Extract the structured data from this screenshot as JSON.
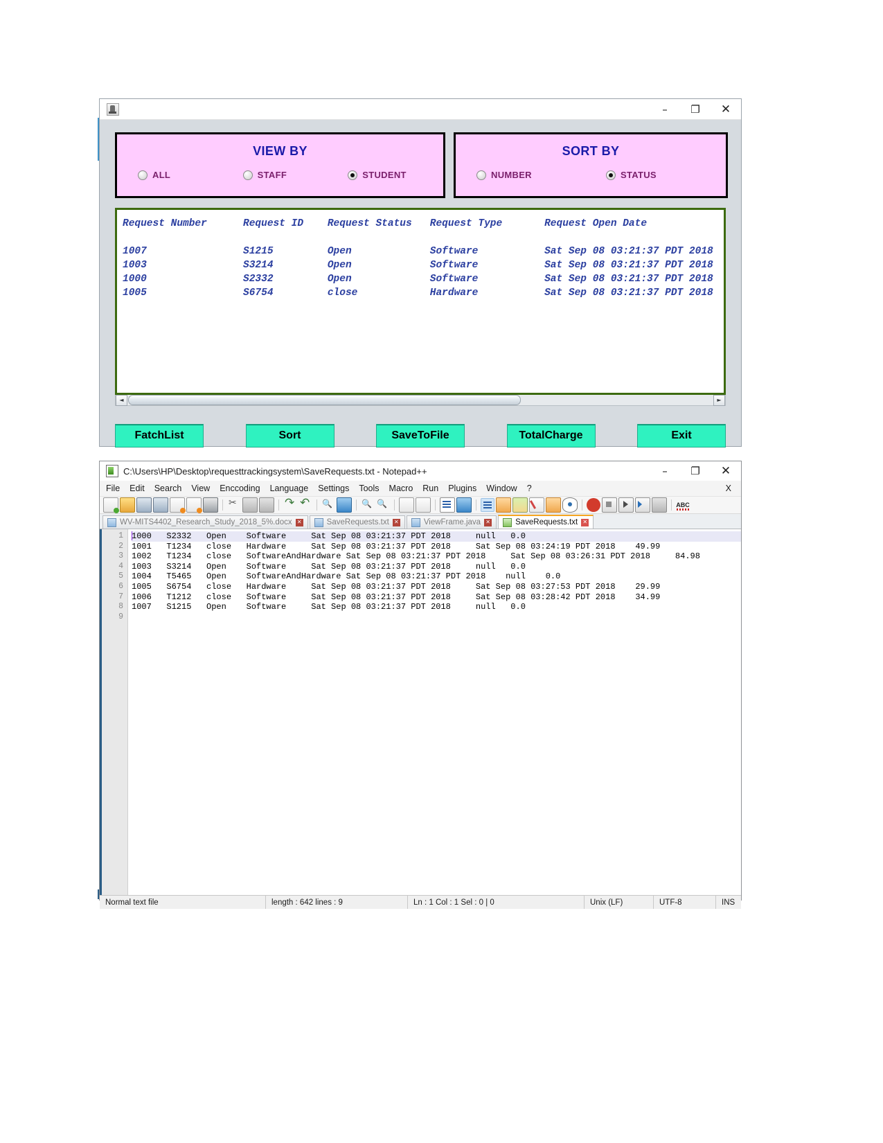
{
  "java_app": {
    "window_icon": "java-coffee-icon",
    "title": "",
    "controls": {
      "minimize": "–",
      "maximize": "❐",
      "close": "✕"
    },
    "view_by": {
      "title": "VIEW BY",
      "options": [
        {
          "label": "ALL",
          "selected": false
        },
        {
          "label": "STAFF",
          "selected": false
        },
        {
          "label": "STUDENT",
          "selected": true
        }
      ]
    },
    "sort_by": {
      "title": "SORT BY",
      "options": [
        {
          "label": "NUMBER",
          "selected": false
        },
        {
          "label": "STATUS",
          "selected": true
        }
      ]
    },
    "results_text": "Request Number      Request ID    Request Status   Request Type       Request Open Date\n\n1007                S1215         Open             Software           Sat Sep 08 03:21:37 PDT 2018\n1003                S3214         Open             Software           Sat Sep 08 03:21:37 PDT 2018\n1000                S2332         Open             Software           Sat Sep 08 03:21:37 PDT 2018\n1005                S6754         close            Hardware           Sat Sep 08 03:21:37 PDT 2018",
    "buttons": [
      {
        "label": "FatchList"
      },
      {
        "label": "Sort"
      },
      {
        "label": "SaveToFile"
      },
      {
        "label": "TotalCharge"
      },
      {
        "label": "Exit"
      }
    ],
    "scrollbar": {
      "left_arrow": "◄",
      "right_arrow": "►"
    }
  },
  "notepad": {
    "title": "C:\\Users\\HP\\Desktop\\requesttrackingsystem\\SaveRequests.txt - Notepad++",
    "controls": {
      "minimize": "–",
      "maximize": "❐",
      "close": "✕",
      "doc_close": "X"
    },
    "menu": [
      "File",
      "Edit",
      "Search",
      "View",
      "Enccoding",
      "Language",
      "Settings",
      "Tools",
      "Macro",
      "Run",
      "Plugins",
      "Window",
      "?"
    ],
    "tabs": [
      {
        "label": "WV-MITS4402_Research_Study_2018_5%.docx",
        "active": false
      },
      {
        "label": "SaveRequests.txt",
        "active": false
      },
      {
        "label": "ViewFrame.java",
        "active": false
      },
      {
        "label": "SaveRequests.txt",
        "active": true
      }
    ],
    "line_numbers": [
      "1",
      "2",
      "3",
      "4",
      "5",
      "6",
      "7",
      "8",
      "9"
    ],
    "lines": [
      "1000   S2332   Open    Software     Sat Sep 08 03:21:37 PDT 2018     null   0.0",
      "1001   T1234   close   Hardware     Sat Sep 08 03:21:37 PDT 2018     Sat Sep 08 03:24:19 PDT 2018    49.99",
      "1002   T1234   close   SoftwareAndHardware Sat Sep 08 03:21:37 PDT 2018     Sat Sep 08 03:26:31 PDT 2018     84.98",
      "1003   S3214   Open    Software     Sat Sep 08 03:21:37 PDT 2018     null   0.0",
      "1004   T5465   Open    SoftwareAndHardware Sat Sep 08 03:21:37 PDT 2018    null    0.0",
      "1005   S6754   close   Hardware     Sat Sep 08 03:21:37 PDT 2018     Sat Sep 08 03:27:53 PDT 2018    29.99",
      "1006   T1212   close   Software     Sat Sep 08 03:21:37 PDT 2018     Sat Sep 08 03:28:42 PDT 2018    34.99",
      "1007   S1215   Open    Software     Sat Sep 08 03:21:37 PDT 2018     null   0.0",
      ""
    ],
    "status": {
      "file_type": "Normal text file",
      "length_lines": "length : 642   lines : 9",
      "position": "Ln : 1   Col : 1   Sel : 0 | 0",
      "eol": "Unix (LF)",
      "encoding": "UTF-8",
      "mode": "INS"
    }
  },
  "colors": {
    "panel_pink": "#ffccff",
    "title_blue": "#1a1aa8",
    "radio_label_purple": "#7a1f6b",
    "results_border_green": "#3d6b10",
    "results_text_blue": "#2b3fa0",
    "button_turquoise": "#2ff2c0",
    "tab_active_orange": "#f5a623"
  }
}
